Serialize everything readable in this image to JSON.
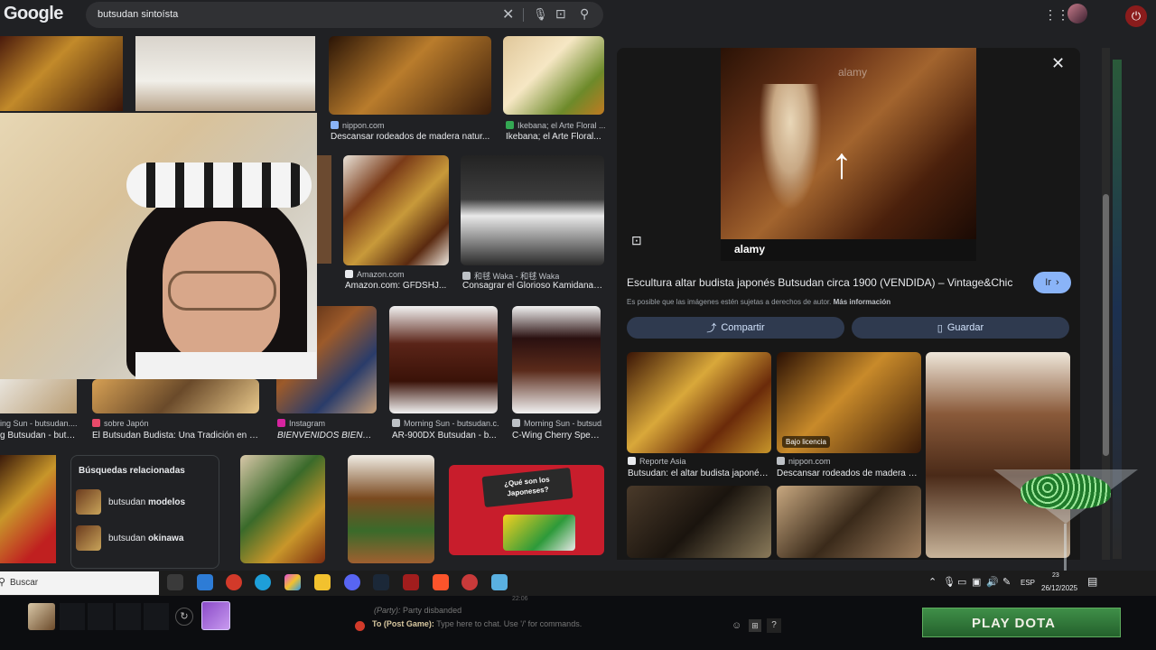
{
  "search": {
    "query": "butsudan sintoísta"
  },
  "logo_text": "Google",
  "grid": {
    "row1": [
      {
        "source": "nippon.com",
        "title": "Descansar rodeados de madera natur..."
      },
      {
        "source": "Ikebana; el Arte Floral ...",
        "title": "Ikebana; el Arte Floral..."
      }
    ],
    "row2": [
      {
        "source": "Amazon.com",
        "title": "Amazon.com: GFDSHJ..."
      },
      {
        "source": "和毬 Waka - 和毬 Waka",
        "title": "Consagrar el Glorioso Kamidana\"..."
      }
    ],
    "row3": [
      {
        "source": "ing Sun - butsudan....",
        "title": "g Butsudan - buts..."
      },
      {
        "source": "sobre Japón",
        "title": "El Butsudan Budista: Una Tradición en lo..."
      },
      {
        "source": "Instagram",
        "title": "BIENVENIDOS BIENVE..."
      },
      {
        "source": "Morning Sun - butsudan.c...",
        "title": "AR-900DX Butsudan - b..."
      },
      {
        "source": "Morning Sun - butsud...",
        "title": "C-Wing Cherry Spec..."
      }
    ]
  },
  "related": {
    "heading": "Búsquedas relacionadas",
    "items": [
      {
        "prefix": "butsudan ",
        "bold": "modelos"
      },
      {
        "prefix": "butsudan ",
        "bold": "okinawa"
      }
    ]
  },
  "thumb_text": {
    "line1": "¿Qué son los",
    "line2": "Japoneses?"
  },
  "preview": {
    "watermark": "alamy",
    "title": "Escultura altar budista japonés Butsudan circa 1900 (VENDIDA) – Vintage&Chic",
    "go_label": "Ir",
    "notice": "Es posible que las imágenes estén sujetas a derechos de autor.",
    "more_info": "Más información",
    "share_label": "Compartir",
    "save_label": "Guardar",
    "related": [
      {
        "source": "Reporte Asia",
        "title": "Butsudan: el altar budista japonés para..."
      },
      {
        "source": "nippon.com",
        "title": "Descansar rodeados de madera natural...",
        "badge": "Bajo licencia"
      }
    ]
  },
  "taskbar": {
    "search_placeholder": "Buscar",
    "lang": "ESP",
    "time": "23",
    "date": "26/12/2025"
  },
  "game": {
    "party_label": "(Party):",
    "party_text": "Party disbanded",
    "chat_channel": "To (Post Game):",
    "chat_placeholder": "Type here to chat. Use '/' for commands.",
    "chat_time": "22:06",
    "help": "?",
    "play_label": "PLAY DOTA"
  },
  "colors": {
    "page_bg": "#202124",
    "preview_bg": "#171717",
    "accent_pill": "#2f3a4f",
    "play_green": "#2f7a3a"
  }
}
